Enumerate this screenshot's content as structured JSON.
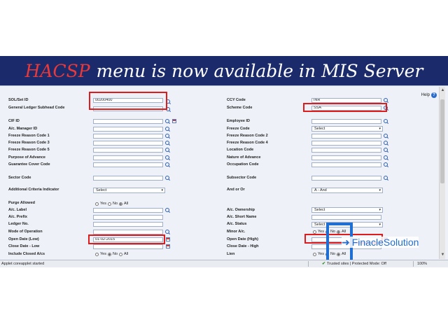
{
  "banner": {
    "highlight": "HACSP",
    "rest": "menu is now available in MIS Server"
  },
  "help": {
    "label": "Help",
    "icon": "help-icon"
  },
  "form": {
    "sol_label": "SOL/Set ID",
    "sol_value": "00200400",
    "gl_subhead_label": "General Ledger Subhead Code",
    "cif_label": "CIF ID",
    "ac_manager_label": "A/c. Manager ID",
    "frz1_label": "Freeze Reason Code 1",
    "frz3_label": "Freeze Reason Code 3",
    "frz5_label": "Freeze Reason Code 5",
    "purpose_label": "Purpose of Advance",
    "guarantee_label": "Guarantee Cover Code",
    "sector_label": "Sector Code",
    "addl_criteria_label": "Additional Criteria Indicator",
    "addl_criteria_value": "Select",
    "purge_label": "Purge Allowed",
    "ac_label_label": "A/c. Label",
    "ac_prefix_label": "A/c. Prefix",
    "ledger_label": "Ledger No.",
    "mode_op_label": "Mode of Operation",
    "open_low_label": "Open Date (Low)",
    "open_low_value": "01-02-2015",
    "close_low_label": "Close Date - Low",
    "incl_closed_label": "Include Closed A/cs",
    "ccy_label": "CCY Code",
    "ccy_value": "INR",
    "scheme_label": "Scheme Code",
    "scheme_value": "SSA",
    "employee_label": "Employee ID",
    "freeze_code_label": "Freeze Code",
    "freeze_code_value": "Select",
    "frz2_label": "Freeze Reason Code 2",
    "frz4_label": "Freeze Reason Code 4",
    "location_label": "Location Code",
    "nature_label": "Nature of Advance",
    "occupation_label": "Occupation Code",
    "subsector_label": "Subsector Code",
    "and_or_label": "And or Or",
    "and_or_value": "A - And",
    "ac_ownership_label": "A/c. Ownership",
    "ac_ownership_value": "Select",
    "ac_short_label": "A/c. Short Name",
    "ac_status_label": "A/c. Status",
    "ac_status_value": "Select",
    "minor_label": "Minor A/c.",
    "open_high_label": "Open Date (High)",
    "close_high_label": "Close Date - High",
    "lien_label": "Lien",
    "radio_yes": "Yes",
    "radio_no": "No",
    "radio_all": "All"
  },
  "watermark": {
    "text": "FinacleSolution",
    "icon": "arrow-right-icon"
  },
  "status": {
    "left": "Applet coreapplet started",
    "security": "Trusted sites | Protected Mode: Off",
    "zoom": "100%"
  },
  "colors": {
    "banner_bg": "#1b2a6b",
    "highlight": "#e83a3a",
    "annotation_red": "#e01b1b",
    "annotation_blue": "#1f6ed4"
  }
}
